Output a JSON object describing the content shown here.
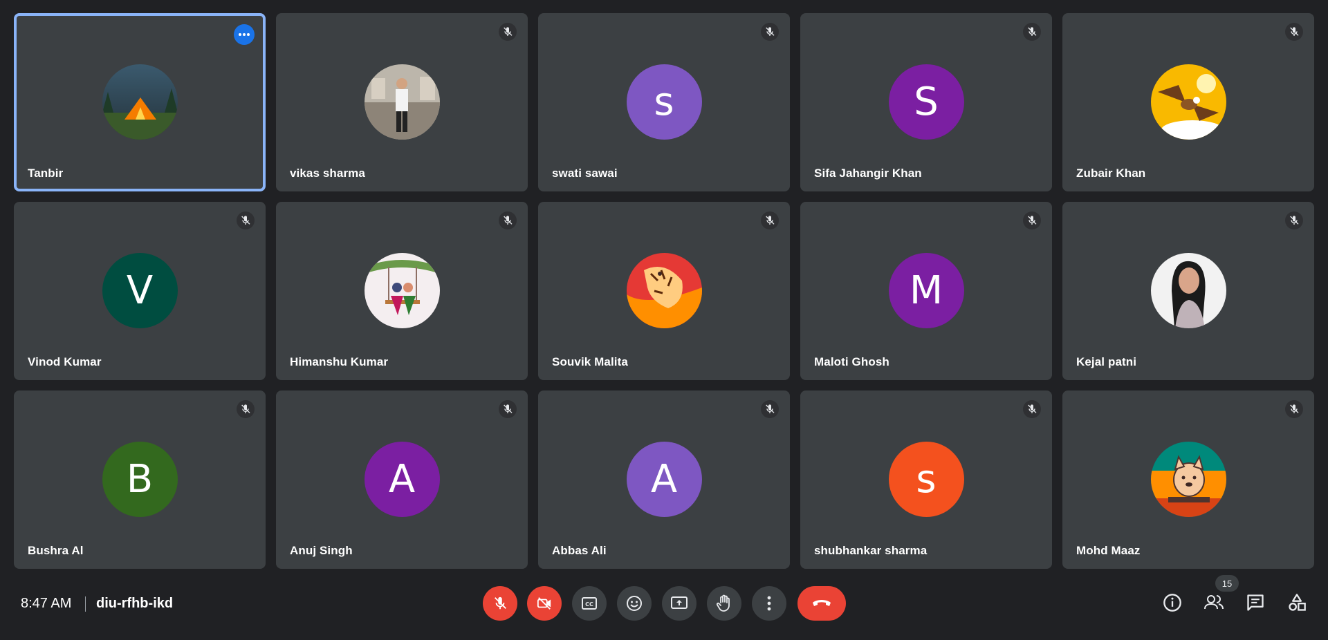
{
  "participants": [
    {
      "name": "Tanbir",
      "initial": "",
      "photo": "tent"
    },
    {
      "name": "vikas sharma",
      "initial": "",
      "photo": "mall"
    },
    {
      "name": "swati sawai",
      "initial": "s",
      "color": "#7e57c2"
    },
    {
      "name": "Sifa Jahangir Khan",
      "initial": "S",
      "color": "#7b1fa2"
    },
    {
      "name": "Zubair Khan",
      "initial": "",
      "photo": "eagle"
    },
    {
      "name": "Vinod Kumar",
      "initial": "V",
      "color": "#004d40"
    },
    {
      "name": "Himanshu Kumar",
      "initial": "",
      "photo": "swing"
    },
    {
      "name": "Souvik Malita",
      "initial": "",
      "photo": "tiger"
    },
    {
      "name": "Maloti Ghosh",
      "initial": "M",
      "color": "#7b1fa2"
    },
    {
      "name": "Kejal patni",
      "initial": "",
      "photo": "woman"
    },
    {
      "name": "Bushra Al",
      "initial": "B",
      "color": "#33691e"
    },
    {
      "name": "Anuj Singh",
      "initial": "A",
      "color": "#7b1fa2"
    },
    {
      "name": "Abbas Ali",
      "initial": "A",
      "color": "#7e57c2"
    },
    {
      "name": "shubhankar sharma",
      "initial": "s",
      "color": "#f4511e"
    },
    {
      "name": "Mohd Maaz",
      "initial": "",
      "photo": "dog"
    }
  ],
  "footer": {
    "time": "8:47 AM",
    "meeting_code": "diu-rfhb-ikd",
    "people_count": "15"
  },
  "colors": {
    "background": "#202124",
    "tile": "#3c4043",
    "active_border": "#8ab4f8",
    "danger": "#ea4335",
    "accent": "#1a73e8"
  }
}
